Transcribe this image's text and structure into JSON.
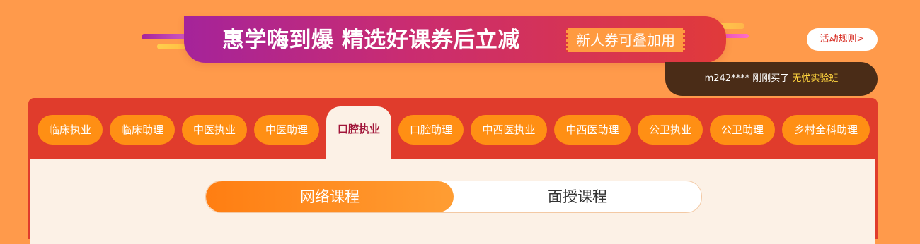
{
  "banner": {
    "title": "惠学嗨到爆 精选好课券后立减",
    "coupon_tag": "新人券可叠加用"
  },
  "rules_button": "活动规则>",
  "ticker": {
    "user": "m242****",
    "action": "刚刚买了",
    "course": "无忧实验班"
  },
  "tabs": [
    {
      "label": "临床执业"
    },
    {
      "label": "临床助理"
    },
    {
      "label": "中医执业"
    },
    {
      "label": "中医助理"
    },
    {
      "label": "口腔执业",
      "active": true
    },
    {
      "label": "口腔助理"
    },
    {
      "label": "中西医执业"
    },
    {
      "label": "中西医助理"
    },
    {
      "label": "公卫执业"
    },
    {
      "label": "公卫助理"
    },
    {
      "label": "乡村全科助理"
    }
  ],
  "course_switch": {
    "online": "网络课程",
    "offline": "面授课程",
    "selected": "网络课程"
  },
  "colors": {
    "page_bg": "#ff9a4b",
    "panel": "#e03c2c",
    "tab": "#ff8f14",
    "active_tab_text": "#a1163a",
    "ticker_bg": "#4a2c17",
    "ticker_highlight": "#ffd43e"
  }
}
